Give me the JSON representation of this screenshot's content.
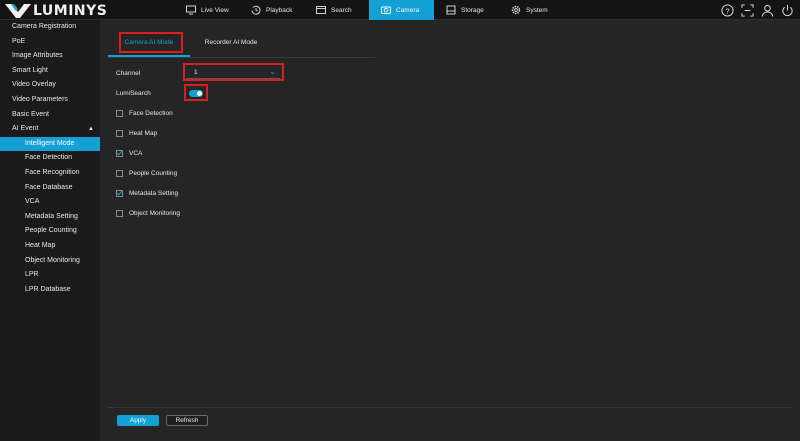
{
  "brand": {
    "name": "LUMINYS",
    "accent": "#13a0d4"
  },
  "nav": [
    {
      "label": "Live View",
      "icon": "monitor-icon",
      "active": false
    },
    {
      "label": "Playback",
      "icon": "history-icon",
      "active": false
    },
    {
      "label": "Search",
      "icon": "folder-search-icon",
      "active": false
    },
    {
      "label": "Camera",
      "icon": "camera-icon",
      "active": true
    },
    {
      "label": "Storage",
      "icon": "storage-icon",
      "active": false
    },
    {
      "label": "System",
      "icon": "gear-icon",
      "active": false
    }
  ],
  "top_icons": [
    "help-icon",
    "fullscreen-icon",
    "user-icon",
    "power-icon"
  ],
  "sidebar": [
    {
      "label": "Camera Registration",
      "sub": false
    },
    {
      "label": "PoE",
      "sub": false
    },
    {
      "label": "Image Attributes",
      "sub": false
    },
    {
      "label": "Smart Light",
      "sub": false
    },
    {
      "label": "Video Overlay",
      "sub": false
    },
    {
      "label": "Video Parameters",
      "sub": false
    },
    {
      "label": "Basic Event",
      "sub": false
    },
    {
      "label": "AI Event",
      "sub": false,
      "expanded": true
    },
    {
      "label": "Intelligent Mode",
      "sub": true,
      "active": true
    },
    {
      "label": "Face Detection",
      "sub": true
    },
    {
      "label": "Face Recognition",
      "sub": true
    },
    {
      "label": "Face Database",
      "sub": true
    },
    {
      "label": "VCA",
      "sub": true
    },
    {
      "label": "Metadata Setting",
      "sub": true
    },
    {
      "label": "People Counting",
      "sub": true
    },
    {
      "label": "Heat Map",
      "sub": true
    },
    {
      "label": "Object Monitoring",
      "sub": true
    },
    {
      "label": "LPR",
      "sub": true
    },
    {
      "label": "LPR Database",
      "sub": true
    }
  ],
  "tabs": [
    {
      "label": "Camera AI Mode",
      "active": true
    },
    {
      "label": "Recorder AI Mode",
      "active": false
    }
  ],
  "form": {
    "channel_label": "Channel",
    "channel_value": "1",
    "lumisearch_label": "LumiSearch",
    "lumisearch_on": true,
    "options": [
      {
        "label": "Face Detection",
        "checked": false
      },
      {
        "label": "Heat Map",
        "checked": false
      },
      {
        "label": "VCA",
        "checked": true
      },
      {
        "label": "People Counting",
        "checked": false
      },
      {
        "label": "Metadata Setting",
        "checked": true
      },
      {
        "label": "Object Monitoring",
        "checked": false
      }
    ]
  },
  "footer": {
    "apply_label": "Apply",
    "refresh_label": "Refresh"
  },
  "highlight_color": "#d81e1e"
}
